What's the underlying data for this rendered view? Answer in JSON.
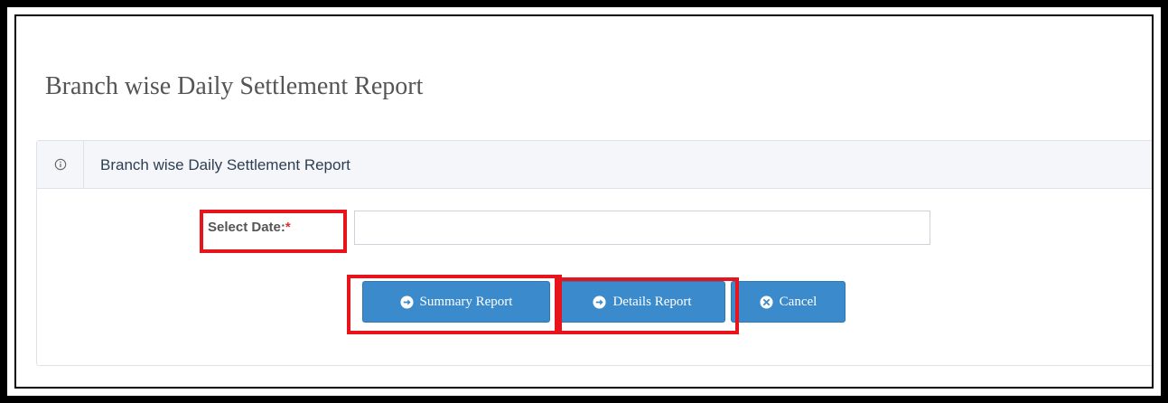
{
  "page": {
    "title": "Branch wise Daily Settlement Report"
  },
  "panel": {
    "title": "Branch wise Daily Settlement Report",
    "icon": "info-circle-icon"
  },
  "form": {
    "date_label": "Select Date:",
    "required_marker": "*",
    "date_value": "",
    "date_placeholder": ""
  },
  "buttons": {
    "summary_label": "Summary Report",
    "details_label": "Details Report",
    "cancel_label": "Cancel",
    "summary_icon": "arrow-circle-right-icon",
    "details_icon": "arrow-circle-right-icon",
    "cancel_icon": "times-circle-icon"
  },
  "colors": {
    "button": "#3b8bcc",
    "highlight": "#e8141c",
    "required": "#d9322e",
    "panel_header": "#f4f6f9"
  }
}
